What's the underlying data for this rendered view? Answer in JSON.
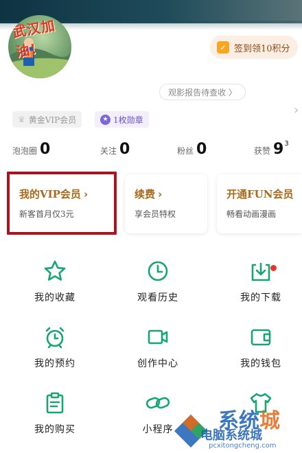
{
  "profile": {
    "avatar_text": "武汉加油!",
    "checkin_label": "签到领10积分",
    "report_label": "观影报告待查收 〉"
  },
  "tags": {
    "vip_label": "黄金VIP会员",
    "badge_label": "1枚勋章"
  },
  "stats": [
    {
      "label": "泡泡圈",
      "value": "0",
      "sup": ""
    },
    {
      "label": "关注",
      "value": "0",
      "sup": ""
    },
    {
      "label": "粉丝",
      "value": "0",
      "sup": ""
    },
    {
      "label": "获赞",
      "value": "9",
      "sup": "3"
    }
  ],
  "cards": [
    {
      "title": "我的VIP会员",
      "subtitle": "新客首月仅3元"
    },
    {
      "title": "续费",
      "subtitle": "享会员特权"
    },
    {
      "title": "开通FUN会员",
      "subtitle": "畅看动画漫画"
    }
  ],
  "grid": [
    {
      "label": "我的收藏",
      "icon": "star-icon"
    },
    {
      "label": "观看历史",
      "icon": "clock-icon"
    },
    {
      "label": "我的下载",
      "icon": "download-icon"
    },
    {
      "label": "我的预约",
      "icon": "alarm-icon"
    },
    {
      "label": "创作中心",
      "icon": "video-camera-icon"
    },
    {
      "label": "我的钱包",
      "icon": "wallet-icon"
    },
    {
      "label": "我的购买",
      "icon": "clipboard-icon"
    },
    {
      "label": "小程序",
      "icon": "link-icon"
    },
    {
      "label": "",
      "icon": "shirt-icon"
    }
  ],
  "watermark": {
    "main_a": "系统",
    "main_b": "城",
    "sub": "电脑系统城",
    "url": "pcxitongcheng.com"
  },
  "colors": {
    "accent_green": "#14a670",
    "card_title": "#a86a1c",
    "highlight_red": "#a5161e"
  }
}
